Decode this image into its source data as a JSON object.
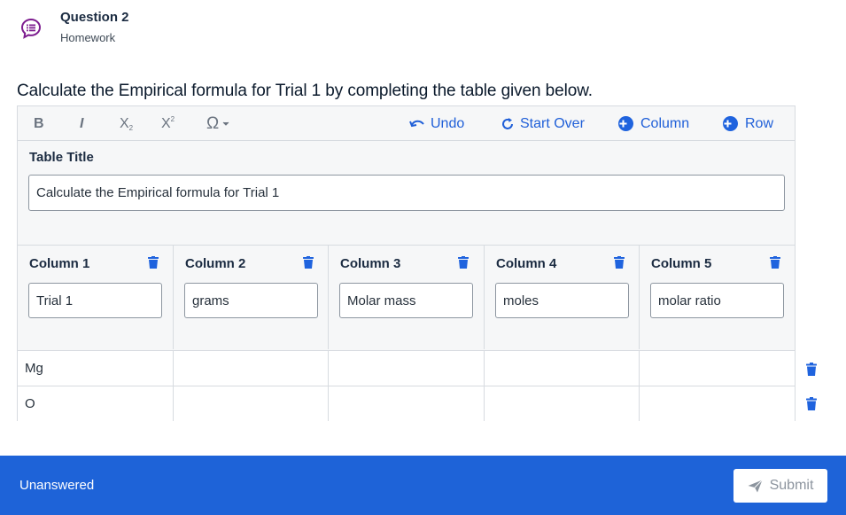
{
  "header": {
    "title": "Question 2",
    "subtitle": "Homework",
    "icon": "question-list-icon",
    "icon_color": "#7d1d8f"
  },
  "prompt": "Calculate the Empirical formula for Trial 1 by completing the table given below.",
  "toolbar": {
    "bold": "B",
    "italic": "I",
    "subscript": "X",
    "sub_mark": "2",
    "superscript": "X",
    "sup_mark": "2",
    "omega": "Ω",
    "undo": "Undo",
    "start_over": "Start Over",
    "add_column": "Column",
    "add_row": "Row"
  },
  "table_title": {
    "label": "Table Title",
    "value": "Calculate the Empirical formula for Trial 1"
  },
  "columns": [
    {
      "label": "Column 1",
      "value": "Trial 1"
    },
    {
      "label": "Column 2",
      "value": "grams"
    },
    {
      "label": "Column 3",
      "value": "Molar mass"
    },
    {
      "label": "Column 4",
      "value": "moles"
    },
    {
      "label": "Column 5",
      "value": "molar ratio"
    }
  ],
  "rows": [
    {
      "cells": [
        "Mg",
        "",
        "",
        "",
        ""
      ]
    },
    {
      "cells": [
        "O",
        "",
        "",
        "",
        ""
      ]
    }
  ],
  "footer": {
    "status": "Unanswered",
    "submit": "Submit"
  },
  "colors": {
    "accent": "#1e63d8",
    "footer_bg": "#1e63d8",
    "link": "#1f5fd8"
  }
}
